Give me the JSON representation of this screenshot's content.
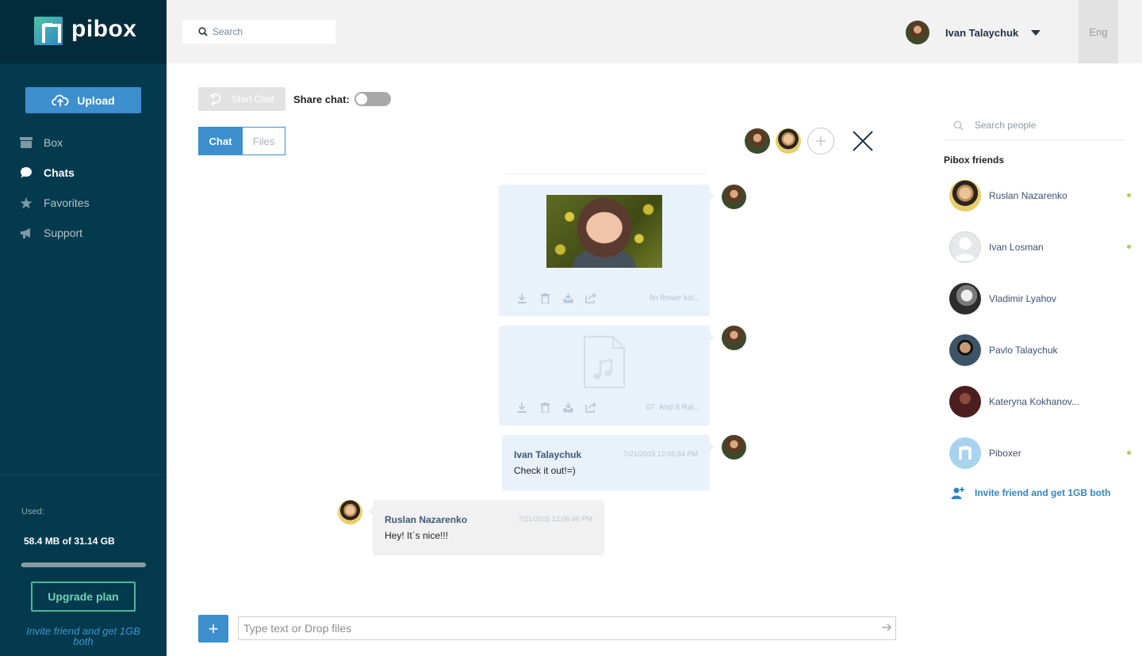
{
  "brand": {
    "name": "pibox"
  },
  "sidebar": {
    "upload_label": "Upload",
    "items": [
      {
        "label": "Box",
        "icon": "box-icon",
        "active": false
      },
      {
        "label": "Chats",
        "icon": "chat-bubble-icon",
        "active": true
      },
      {
        "label": "Favorites",
        "icon": "star-icon",
        "active": false
      },
      {
        "label": "Support",
        "icon": "megaphone-icon",
        "active": false
      }
    ],
    "used_label": "Used:",
    "used_value": "58.4 MB of 31.14 GB",
    "used_fraction": 0.002,
    "upgrade_label": "Upgrade plan",
    "invite_text": "Invite friend and get 1GB both"
  },
  "header": {
    "search_placeholder": "Search",
    "user_name": "Ivan Talaychuk",
    "language": "Eng"
  },
  "toolbar": {
    "start_chat_label": "Start Chat",
    "share_chat_label": "Share chat:",
    "share_chat_enabled": false,
    "tabs": [
      {
        "label": "Chat",
        "active": true
      },
      {
        "label": "Files",
        "active": false
      }
    ]
  },
  "messages": [
    {
      "type": "image",
      "file_name": "fin flower kst..."
    },
    {
      "type": "audio",
      "file_name": "07. And It Rai..."
    },
    {
      "type": "text",
      "sender": "Ivan Talaychuk",
      "time": "7/21/2015 12:05:54 PM",
      "text": "Check it out!=)"
    },
    {
      "type": "text",
      "sender": "Ruslan Nazarenko",
      "time": "7/21/2015 12:06:46 PM",
      "text": "Hey! It`s nice!!!"
    }
  ],
  "composer": {
    "placeholder": "Type text or Drop files",
    "add_label": "+"
  },
  "people": {
    "search_placeholder": "Search people",
    "friends_title": "Pibox friends",
    "friends": [
      {
        "name": "Ruslan Nazarenko",
        "online": true
      },
      {
        "name": "Ivan Losman",
        "online": true
      },
      {
        "name": "Vladimir Lyahov",
        "online": false
      },
      {
        "name": "Pavlo Talaychuk",
        "online": false
      },
      {
        "name": "Kateryna Kokhanov...",
        "online": false
      },
      {
        "name": "Piboxer",
        "online": true
      }
    ],
    "invite_text": "Invite friend and get 1GB both"
  },
  "colors": {
    "accent": "#3d8fcd",
    "sidebar_bg": "#043a4d",
    "upgrade": "#48b99a",
    "online": "#9ed35a"
  }
}
